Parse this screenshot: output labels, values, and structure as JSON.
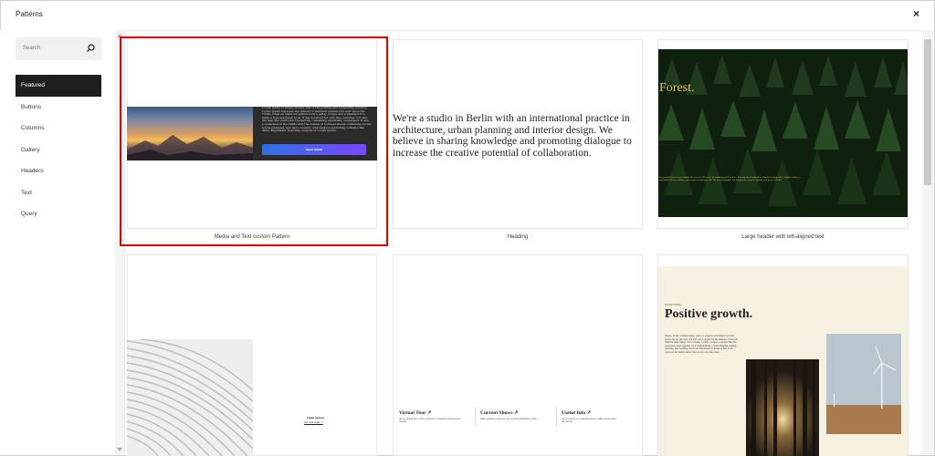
{
  "modal": {
    "title": "Patterns",
    "close_label": "×"
  },
  "search": {
    "placeholder": "Search"
  },
  "categories": [
    {
      "label": "Featured",
      "active": true
    },
    {
      "label": "Buttons"
    },
    {
      "label": "Columns"
    },
    {
      "label": "Gallery"
    },
    {
      "label": "Headers"
    },
    {
      "label": "Text"
    },
    {
      "label": "Query"
    }
  ],
  "patterns": {
    "media_text": {
      "label": "Media and Text custom Pattern",
      "body": "Lorem Ipsum is simply dummy text of the printing and typesetting industry. Lorem Ipsum has been the industry's standard dummy text ever since the 1500s, when an unknown printer took a galley of type and scrambled it to make a type specimen book. It has survived not only five centuries, but also the leap into electronic typesetting, remaining essentially unchanged. It was popularised in the 1960s with the release of Letraset sheets containing Lorem Ipsum passages, and more recently with desktop publishing software like Aldus PageMaker including versions of Lorem Ipsum.",
      "button": "READ MORE"
    },
    "heading": {
      "label": "Heading",
      "text": "We're a studio in Berlin with an international practice in architecture, urban planning and interior design. We believe in sharing knowledge and promoting dialogue to increase the creative potential of collaboration."
    },
    "large_header": {
      "label": "Large header with left-aligned text",
      "title": "Forest.",
      "body": "Even a child knows how valuable the forest is. The fresh, breathtaking smell of trees. Echoing birds flying above that dense magnitude. A stable climate, a sustainable diverse wildlife, and a source of raw-material. The forest stimulates our imagination, helps us breathe, and gives us shelter."
    },
    "offset": {
      "title": "Open Spaces",
      "link": "See case study ↗"
    },
    "three_columns": {
      "columns": [
        {
          "title": "Virtual Tour ↗",
          "text": "Get a virtual tour of the museum. Ideal for schools and events."
        },
        {
          "title": "Current Shows ↗",
          "text": "Stay updated and see our current exhibitions here."
        },
        {
          "title": "Useful Info ↗",
          "text": "Get to know our opening times, ticket prices and discounts."
        }
      ]
    },
    "growth": {
      "eyebrow": "ECOSYSTEM",
      "title": "Positive growth.",
      "body": "Nature, in the common sense, refers to essences unchanged by man; space, the air, the river, the leaf. Art is applied to the mixture of his will with the same things, as in a house, a canal, a statue, a picture. But his operations taken together are so insignificant, a little chipping, baking, patching, and washing, that in an impression so grand as that of the world on the human mind, they do not vary the result."
    }
  },
  "colors": {
    "highlight": "#e00000",
    "active_nav": "#1e1e1e",
    "forest_text": "#e4c36b",
    "growth_bg": "#f6f1e1"
  }
}
